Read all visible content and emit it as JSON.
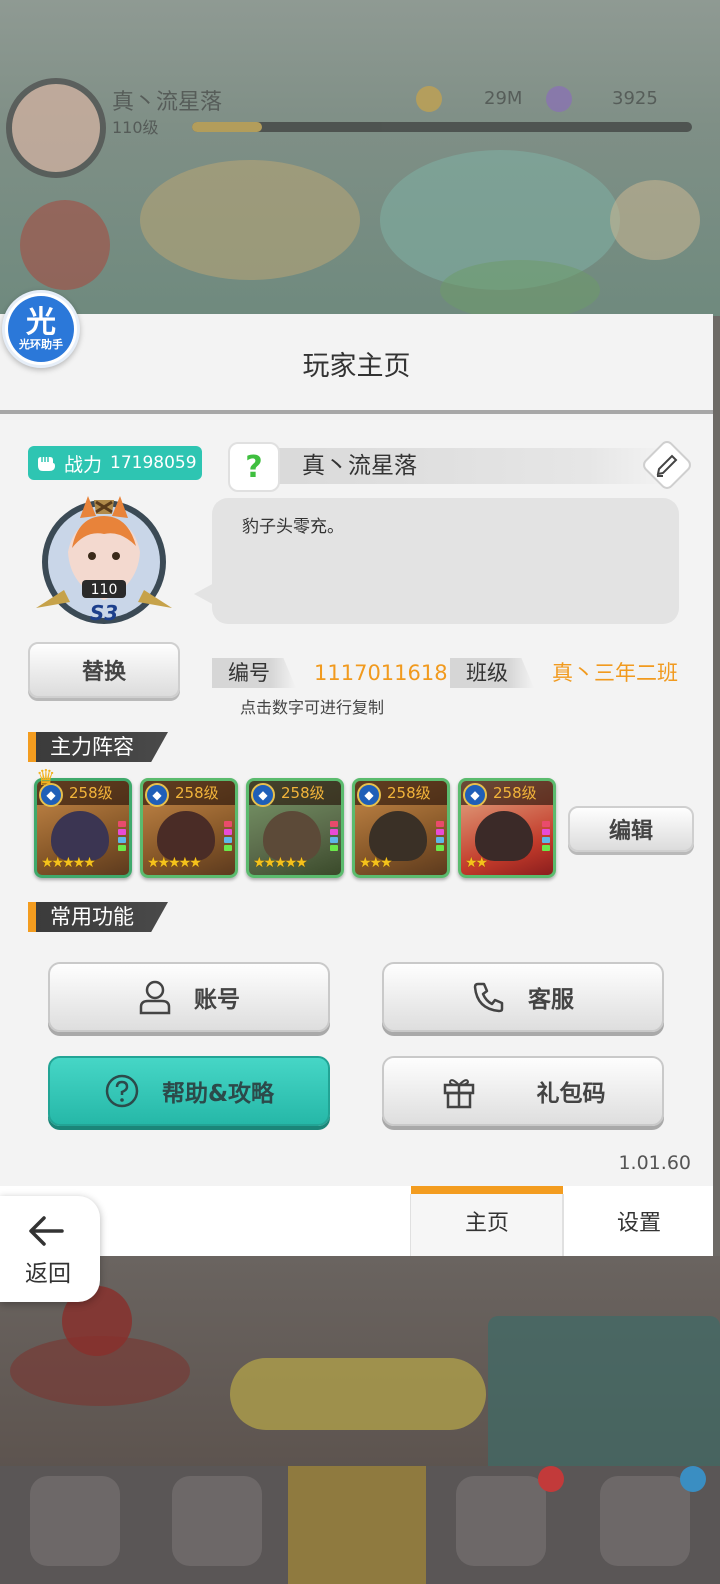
{
  "background": {
    "player_name": "真丶流星落",
    "player_level": "110级",
    "gold": "29M",
    "gems": "3925"
  },
  "assistant": {
    "char": "光",
    "label": "光环助手"
  },
  "panel": {
    "title": "玩家主页"
  },
  "profile": {
    "power_label": "战力",
    "power_value": "17198059",
    "avatar_level": "110",
    "avatar_rank": "S3",
    "swap_label": "替换",
    "name": "真丶流星落",
    "signature": "豹子头零充。",
    "id_label": "编号",
    "id_value": "1117011618",
    "class_label": "班级",
    "class_value": "真丶三年二班",
    "copy_tip": "点击数字可进行复制"
  },
  "lineup": {
    "section_title": "主力阵容",
    "edit_label": "编辑",
    "heroes": [
      {
        "level": "258级",
        "stars": "★★★★★",
        "frame": "#3fa96b",
        "face": "#3b3552"
      },
      {
        "level": "258级",
        "stars": "★★★★★",
        "frame": "#5bbb6e",
        "face": "#4a2c26"
      },
      {
        "level": "258级",
        "stars": "★★★★★",
        "frame": "#5bbb6e",
        "face": "#5c4a38"
      },
      {
        "level": "258级",
        "stars": "★★★",
        "frame": "#5bbb6e",
        "face": "#3a3026"
      },
      {
        "level": "258级",
        "stars": "★★",
        "frame": "#5bbb6e",
        "face": "#3b2a28"
      }
    ]
  },
  "functions": {
    "section_title": "常用功能",
    "account_label": "账号",
    "service_label": "客服",
    "help_label": "帮助&攻略",
    "gift_label": "礼包码"
  },
  "version": "1.01.60",
  "tabs": {
    "home": "主页",
    "settings": "设置"
  },
  "back_label": "返回",
  "colors": {
    "accent_orange": "#f39c1f",
    "teal": "#2ec5b2",
    "id_orange": "#f19a1e"
  }
}
